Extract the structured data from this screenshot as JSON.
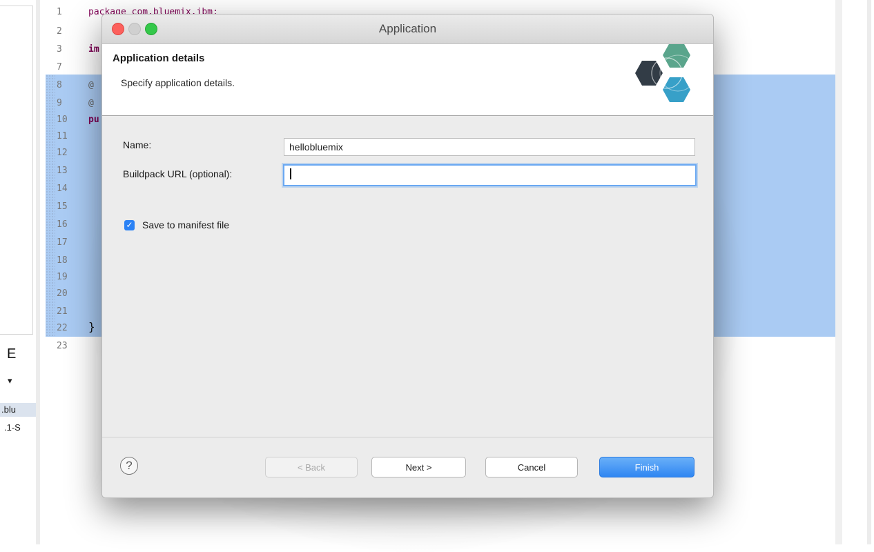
{
  "left_panel": {
    "title_glyph": "E",
    "chevron": "▾",
    "items": [
      ".blu",
      ".1-S"
    ]
  },
  "editor": {
    "line_numbers": [
      "1",
      "2",
      "3",
      "7",
      "8",
      "9",
      "10",
      "11",
      "12",
      "13",
      "14",
      "15",
      "16",
      "17",
      "18",
      "19",
      "20",
      "21",
      "22",
      "23"
    ],
    "code_fragments": {
      "line1": "package com.bluemix.ibm;",
      "line3": "im",
      "line8": "@",
      "line9": "@",
      "line10": "pu",
      "line22": "}"
    }
  },
  "dialog": {
    "window_title": "Application",
    "header": {
      "title": "Application details",
      "subtitle": "Specify application details."
    },
    "form": {
      "name_label": "Name:",
      "name_value": "hellobluemix",
      "buildpack_label": "Buildpack URL (optional):",
      "buildpack_value": "",
      "save_manifest_label": "Save to manifest file",
      "save_manifest_checked": true
    },
    "footer": {
      "help_glyph": "?",
      "back_label": "< Back",
      "next_label": "Next >",
      "cancel_label": "Cancel",
      "finish_label": "Finish"
    }
  },
  "colors": {
    "accent": "#2f86f2",
    "selection": "#aacbf3",
    "logo_dark": "#323c46",
    "logo_green": "#5aa58c",
    "logo_teal": "#37a0c8"
  }
}
